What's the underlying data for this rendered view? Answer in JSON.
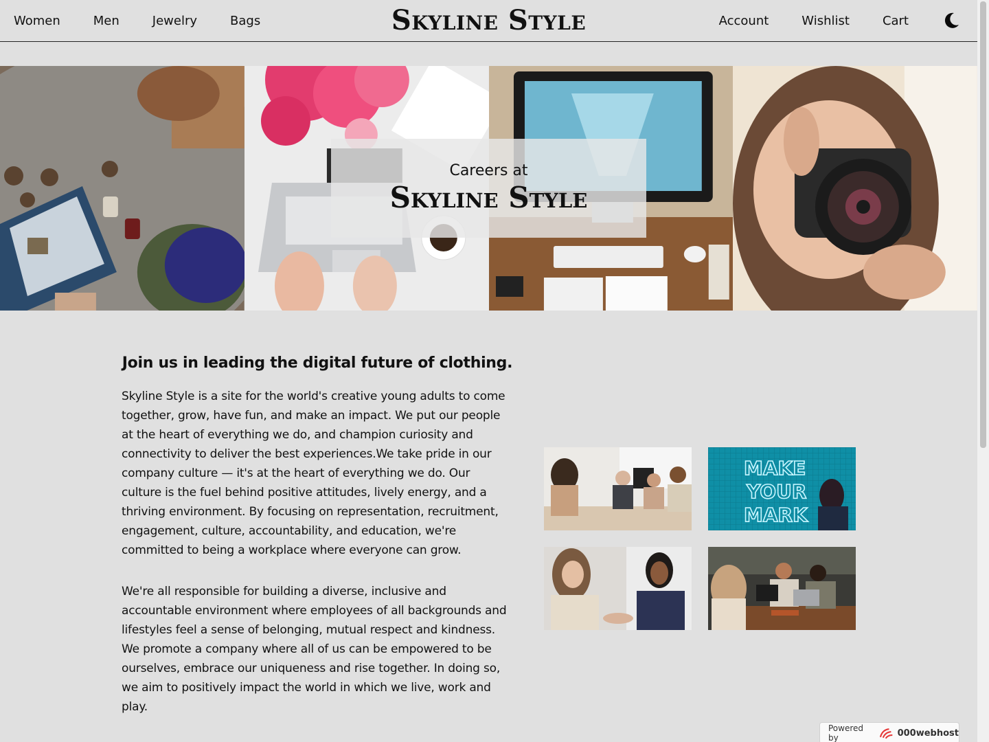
{
  "header": {
    "nav_left": [
      "Women",
      "Men",
      "Jewelry",
      "Bags"
    ],
    "logo": "Skyline Style",
    "nav_right": [
      "Account",
      "Wishlist",
      "Cart"
    ],
    "theme_toggle_icon": "moon-icon"
  },
  "hero": {
    "subtitle": "Careers at",
    "title": "Skyline Style",
    "images": [
      "laptop-drawing-photo",
      "workspace-flowers-photo",
      "digital-marketing-desk-photo",
      "photographer-camera-photo"
    ]
  },
  "content": {
    "heading": "Join us in leading the digital future of clothing.",
    "paragraph_1": "Skyline Style is a site for the world's creative young adults to come together, grow, have fun, and make an impact. We put our people at the heart of everything we do, and champion curiosity and connectivity to deliver the best experiences.We take pride in our company culture — it's at the heart of everything we do. Our culture is the fuel behind positive attitudes, lively energy, and a thriving environment. By focusing on representation, recruitment, engagement, culture, accountability, and education, we're committed to being a workplace where everyone can grow.",
    "paragraph_2": "We're all responsible for building a diverse, inclusive and accountable environment where employees of all backgrounds and lifestyles feel a sense of belonging, mutual respect and kindness. We promote a company where all of us can be empowered to be ourselves, embrace our uniqueness and rise together. In doing so, we aim to positively impact the world in which we live, work and play."
  },
  "gallery": {
    "neon_sign_text": [
      "MAKE",
      "YOUR",
      "MARK"
    ]
  },
  "badge": {
    "prefix": "Powered by",
    "brand": "000webhost"
  }
}
